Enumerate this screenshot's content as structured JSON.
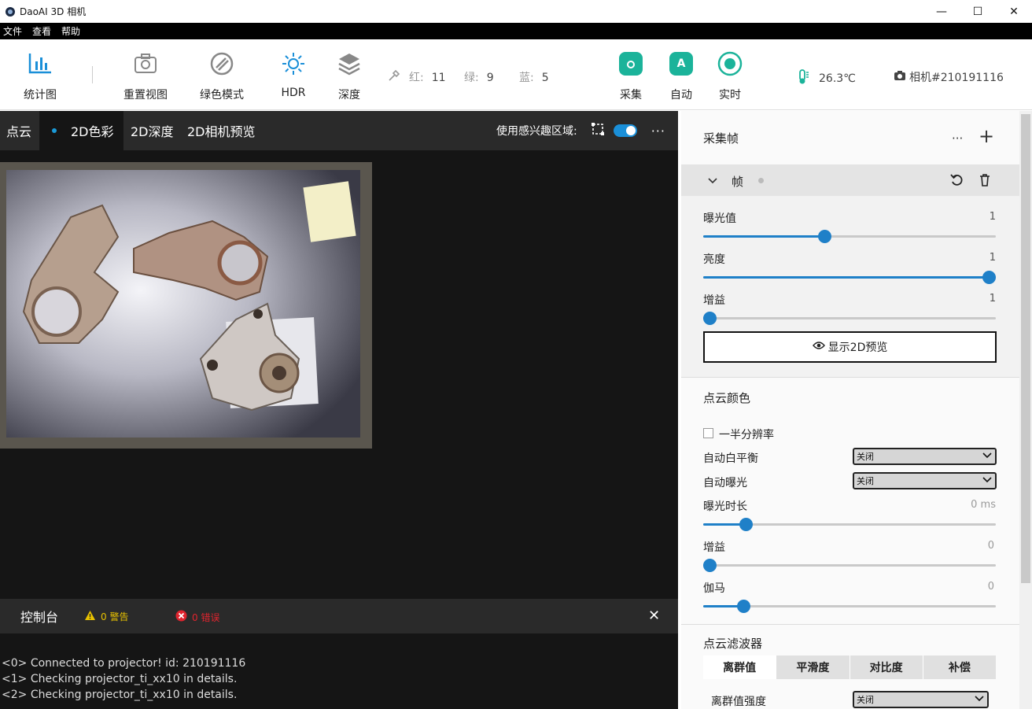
{
  "window": {
    "title": "DaoAI 3D 相机",
    "minimize": "—",
    "maximize": "☐",
    "close": "✕"
  },
  "menu": [
    "文件",
    "查看",
    "帮助"
  ],
  "toolbar": {
    "histogram": "统计图",
    "reset_view": "重置视图",
    "green_mode": "绿色模式",
    "hdr": "HDR",
    "depth": "深度",
    "rgb": {
      "r_label": "红:",
      "r_value": "11",
      "g_label": "绿:",
      "g_value": "9",
      "b_label": "蓝:",
      "b_value": "5"
    },
    "capture": "采集",
    "auto": "自动",
    "auto_glyph": "A",
    "live": "实时",
    "temperature": "26.3℃",
    "camera": "相机#210191116"
  },
  "view_tabs": [
    "点云",
    "2D色彩",
    "2D深度",
    "2D相机预览"
  ],
  "roi_label": "使用感兴趣区域:",
  "more": "···",
  "console": {
    "title": "控制台",
    "warnings": "0 警告",
    "errors": "0 错误",
    "close": "✕",
    "lines": [
      "<0> Connected to projector! id: 210191116",
      "<1> Checking projector_ti_xx10 in details.",
      "<2> Checking projector_ti_xx10 in details."
    ]
  },
  "panel": {
    "capture_frames": "采集帧",
    "more": "···",
    "add": "+",
    "frame_label": "帧",
    "exposure": {
      "label": "曝光值",
      "value": "1",
      "fraction": 0.41
    },
    "brightness": {
      "label": "亮度",
      "value": "1",
      "fraction": 1.0
    },
    "gain": {
      "label": "增益",
      "value": "1",
      "fraction": 0.0
    },
    "show_preview": "显示2D预览",
    "pc_color": "点云颜色",
    "half_res": "一半分辨率",
    "auto_wb": {
      "label": "自动白平衡",
      "value": "关闭"
    },
    "auto_exp": {
      "label": "自动曝光",
      "value": "关闭"
    },
    "exp_time": {
      "label": "曝光时长",
      "value": "0 ms",
      "fraction": 0.13
    },
    "gain2": {
      "label": "增益",
      "value": "0",
      "fraction": 0.0
    },
    "gamma": {
      "label": "伽马",
      "value": "0",
      "fraction": 0.12
    },
    "pc_filter": "点云滤波器",
    "filter_tabs": [
      "离群值",
      "平滑度",
      "对比度",
      "补偿"
    ],
    "outlier_strength": {
      "label": "离群值强度",
      "value": "关闭"
    }
  },
  "colors": {
    "accent": "#1f80c8",
    "teal": "#1bb39a",
    "dark": "#151515",
    "warn": "#e8c200",
    "error": "#e0242e"
  }
}
